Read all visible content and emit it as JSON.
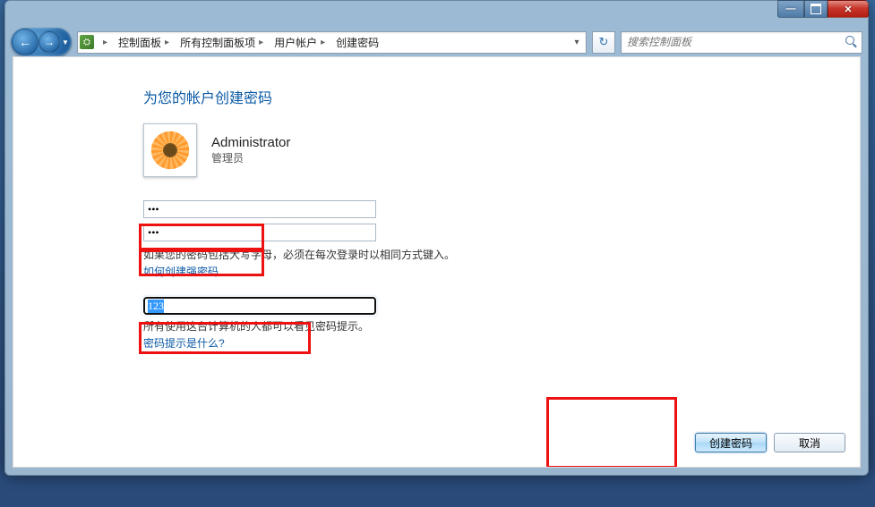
{
  "window": {
    "caption_min": "—",
    "caption_close": "✕"
  },
  "breadcrumb": {
    "items": [
      {
        "label": "控制面板"
      },
      {
        "label": "所有控制面板项"
      },
      {
        "label": "用户帐户"
      },
      {
        "label": "创建密码"
      }
    ]
  },
  "search": {
    "placeholder": "搜索控制面板"
  },
  "page": {
    "title": "为您的帐户创建密码"
  },
  "user": {
    "name": "Administrator",
    "role": "管理员"
  },
  "form": {
    "password_value": "•••",
    "password_confirm_value": "•••",
    "caps_note": "如果您的密码包括大写字母，必须在每次登录时以相同方式键入。",
    "strong_link": "如何创建强密码",
    "hint_value": "123",
    "hint_note": "所有使用这台计算机的人都可以看见密码提示。",
    "hint_link": "密码提示是什么?"
  },
  "buttons": {
    "create": "创建密码",
    "cancel": "取消"
  }
}
